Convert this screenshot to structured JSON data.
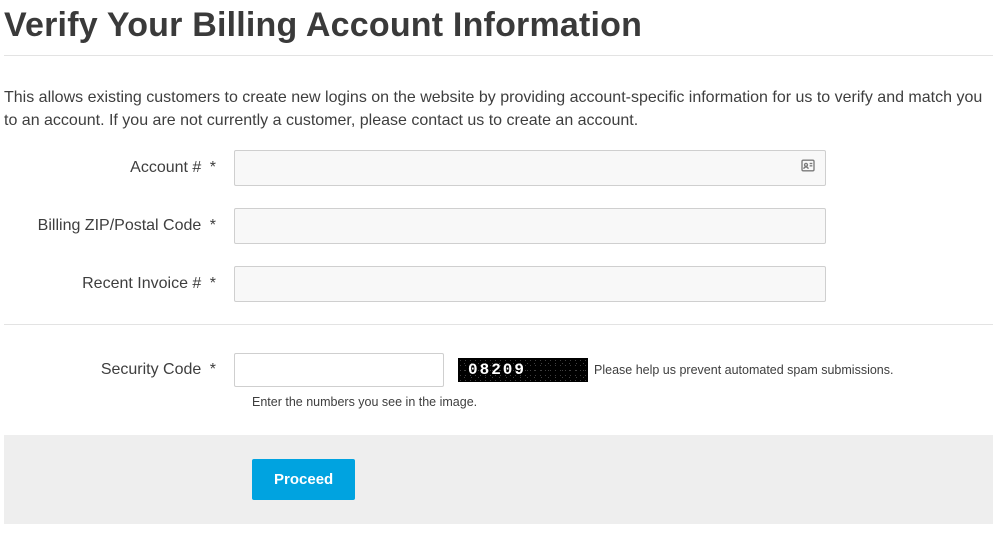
{
  "heading": "Verify Your Billing Account Information",
  "intro": "This allows existing customers to create new logins on the website by providing account-specific information for us to verify and match you to an account. If you are not currently a customer, please contact us to create an account.",
  "required_marker": "*",
  "fields": {
    "account": {
      "label": "Account #",
      "value": ""
    },
    "zip": {
      "label": "Billing ZIP/Postal Code",
      "value": ""
    },
    "invoice": {
      "label": "Recent Invoice #",
      "value": ""
    }
  },
  "captcha": {
    "label": "Security Code",
    "value": "",
    "image_text": "08209",
    "help": "Please help us prevent automated spam submissions.",
    "hint": "Enter the numbers you see in the image."
  },
  "actions": {
    "proceed": "Proceed"
  }
}
